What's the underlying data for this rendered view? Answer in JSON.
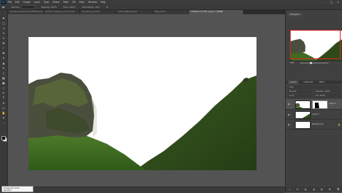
{
  "menu": {
    "logo": "Ps",
    "items": [
      "File",
      "Edit",
      "Image",
      "Layer",
      "Type",
      "Select",
      "Filter",
      "3D",
      "View",
      "Window",
      "Help"
    ],
    "window_controls": [
      "–",
      "□",
      "×"
    ]
  },
  "options": {
    "items": [
      "Opacity: 100%",
      "Flow: 100%",
      "Smoothing: 10%"
    ],
    "mode_label": "Mode:"
  },
  "tabs": [
    {
      "label": "mountain_landscape_8749456_ps.jpg",
      "active": false
    },
    {
      "label": "summer_valley_ps_ps_rock.psd",
      "active": false
    },
    {
      "label": "sky_hills_ps_ps.psd",
      "active": false
    },
    {
      "label": "rocks_edited_ps.psd",
      "active": false
    },
    {
      "label": "hills_ps.psd",
      "active": false
    },
    {
      "label": "Untitled-1 @ 50% (Layer 1, RGB/8)",
      "active": true
    }
  ],
  "tool_icons": [
    "move-icon",
    "marquee-icon",
    "lasso-icon",
    "quick-select-icon",
    "crop-icon",
    "frame-icon",
    "eyedropper-icon",
    "healing-icon",
    "brush-icon",
    "clone-stamp-icon",
    "history-brush-icon",
    "eraser-icon",
    "gradient-icon",
    "blur-icon",
    "dodge-icon",
    "pen-icon",
    "type-icon",
    "path-select-icon",
    "rectangle-icon",
    "hand-icon",
    "zoom-icon",
    "more-icon"
  ],
  "status": {
    "zoom": "50%"
  },
  "tooltip": {
    "line1": "Foreground Color",
    "line2": "Shortcut"
  },
  "right_panel": {
    "navigator_tab": "Navigator",
    "zoom_value": "50%",
    "layer_tabs": [
      "Layers",
      "Channels",
      "Paths"
    ],
    "kind_label": "Kind",
    "blend_mode": "Normal",
    "opacity_label": "Opacity: 100%",
    "lock_label": "Lock:",
    "fill_label": "Fill: 100%",
    "layers": [
      {
        "name": "Layer 1",
        "selected": true
      },
      {
        "name": "Layer 0",
        "selected": false
      },
      {
        "name": "Background",
        "selected": false
      }
    ],
    "footer_icons": [
      "link-icon",
      "fx-icon",
      "mask-icon",
      "adjustment-icon",
      "group-icon",
      "new-layer-icon",
      "trash-icon"
    ]
  },
  "colors": {
    "accent": "#31a8ff",
    "panel": "#404040",
    "canvas_bg": "#535353"
  }
}
